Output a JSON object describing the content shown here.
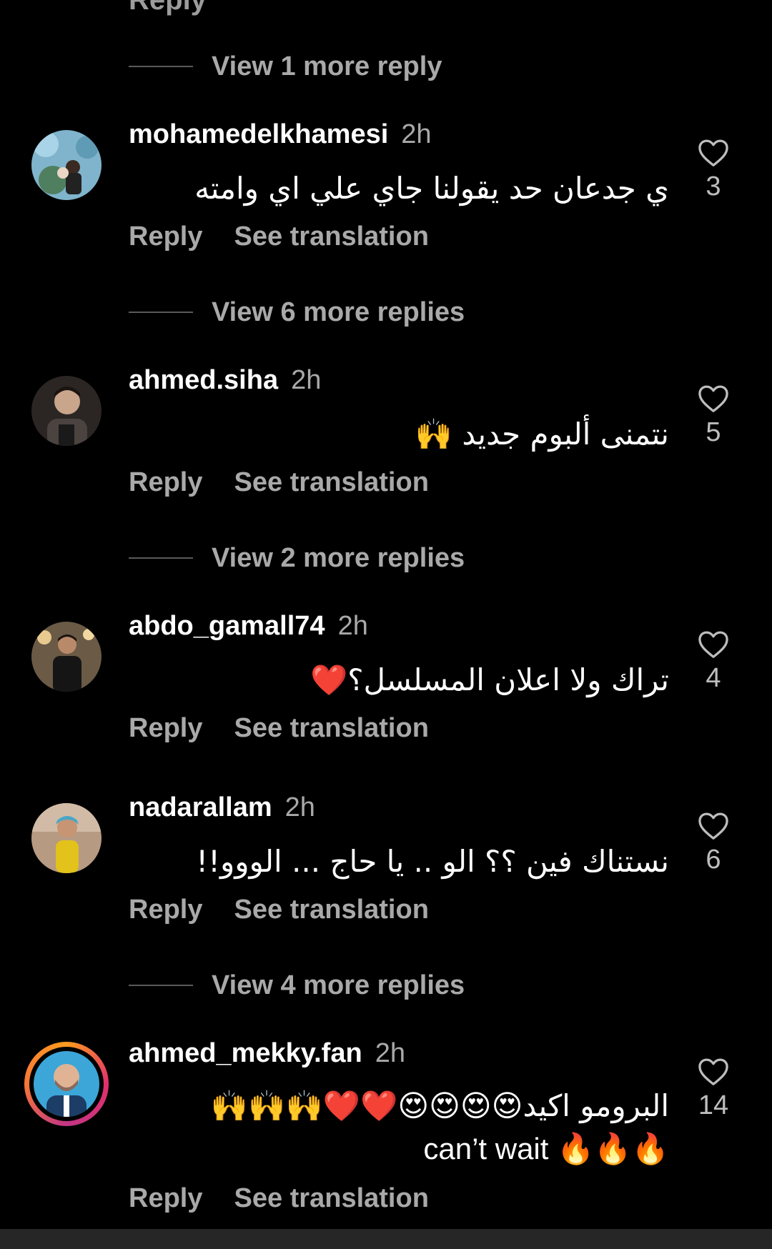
{
  "top_cut_label": "Reply",
  "icons": {
    "heart": "heart-outline-icon"
  },
  "colors": {
    "background": "#000000",
    "primary_text": "#ffffff",
    "secondary_text": "#a9a9a9",
    "separator": "#5a5a5a"
  },
  "view_more_1": "View 1 more reply",
  "view_more_2": "View 6 more replies",
  "view_more_3": "View 2 more replies",
  "view_more_4": "View 4 more replies",
  "comments": [
    {
      "username": "mohamedelkhamesi",
      "time": "2h",
      "text": "ي جدعان حد يقولنا جاي علي اي وامته",
      "reply": "Reply",
      "translate": "See translation",
      "likes": "3"
    },
    {
      "username": "ahmed.siha",
      "time": "2h",
      "text": "نتمنى ألبوم جديد 🙌",
      "reply": "Reply",
      "translate": "See translation",
      "likes": "5"
    },
    {
      "username": "abdo_gamall74",
      "time": "2h",
      "text": "تراك ولا اعلان المسلسل؟❤️",
      "reply": "Reply",
      "translate": "See translation",
      "likes": "4"
    },
    {
      "username": "nadarallam",
      "time": "2h",
      "text": "نستناك فين ؟؟ الو .. يا حاج ... الووو!!",
      "reply": "Reply",
      "translate": "See translation",
      "likes": "6"
    },
    {
      "username": "ahmed_mekky.fan",
      "time": "2h",
      "text_line1": "البرومو اكيد😍😍😍😍❤️❤️🙌🙌🙌",
      "text_line2": "can’t wait 🔥🔥🔥",
      "reply": "Reply",
      "translate": "See translation",
      "likes": "14"
    }
  ]
}
